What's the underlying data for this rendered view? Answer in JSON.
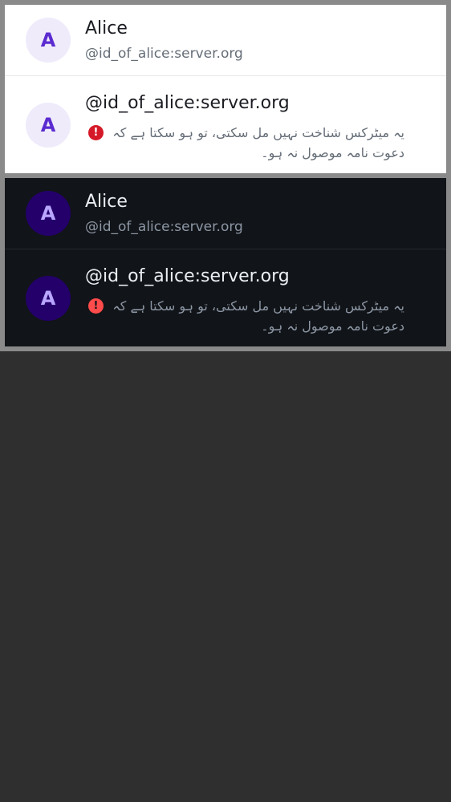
{
  "light": {
    "member": {
      "avatar_letter": "A",
      "display_name": "Alice",
      "user_id": "@id_of_alice:server.org"
    },
    "unknown": {
      "avatar_letter": "A",
      "user_id": "@id_of_alice:server.org",
      "warning_icon": "error-icon",
      "warning_text": "یہ میٹرکس شناخت نہیں مل سکتی، تو ہو سکتا ہے کہ دعوت نامہ موصول نہ ہو۔"
    }
  },
  "dark": {
    "member": {
      "avatar_letter": "A",
      "display_name": "Alice",
      "user_id": "@id_of_alice:server.org"
    },
    "unknown": {
      "avatar_letter": "A",
      "user_id": "@id_of_alice:server.org",
      "warning_icon": "error-icon",
      "warning_text": "یہ میٹرکس شناخت نہیں مل سکتی، تو ہو سکتا ہے کہ دعوت نامہ موصول نہ ہو۔"
    }
  },
  "colors": {
    "light_background": "#ffffff",
    "dark_background": "#111418",
    "light_avatar_bg": "#efebfb",
    "light_avatar_fg": "#5b2bd0",
    "dark_avatar_bg": "#24006b",
    "dark_avatar_fg": "#b9a6ff",
    "error_light": "#d51928",
    "error_dark": "#fe4b4b"
  }
}
